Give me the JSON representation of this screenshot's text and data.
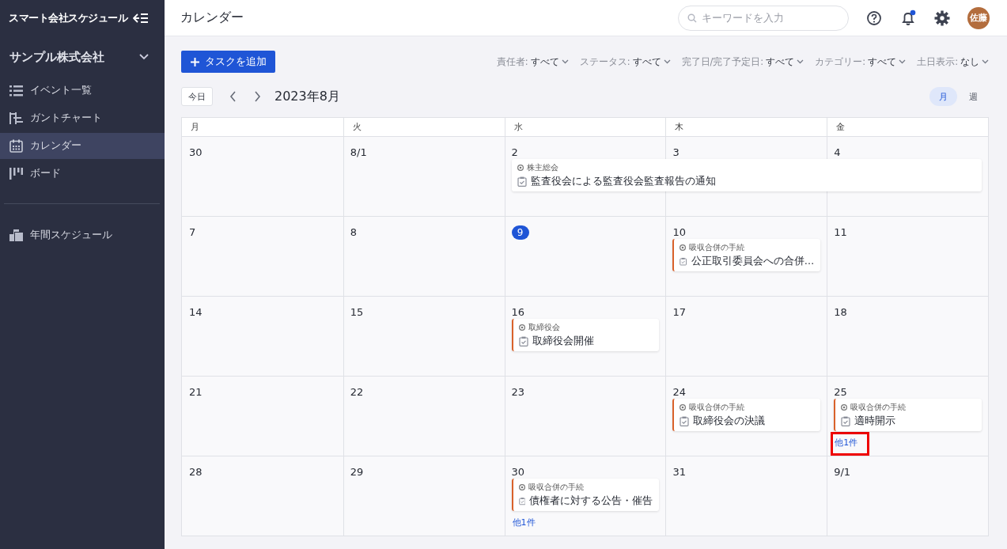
{
  "app": {
    "title": "スマート会社スケジュール",
    "company": "サンプル株式会社"
  },
  "sidebar": {
    "items": [
      {
        "label": "イベント一覧",
        "selected": false
      },
      {
        "label": "ガントチャート",
        "selected": false
      },
      {
        "label": "カレンダー",
        "selected": true
      },
      {
        "label": "ボード",
        "selected": false
      }
    ],
    "footer_items": [
      {
        "label": "年間スケジュール",
        "selected": false
      }
    ]
  },
  "header": {
    "title": "カレンダー",
    "search": {
      "placeholder": "キーワードを入力"
    },
    "notifications_unread": true,
    "avatar": "佐藤"
  },
  "toolbar": {
    "add_button": "タスクを追加",
    "filters": [
      {
        "label": "責任者:",
        "value": "すべて"
      },
      {
        "label": "ステータス:",
        "value": "すべて"
      },
      {
        "label": "完了日/完了予定日:",
        "value": "すべて"
      },
      {
        "label": "カテゴリー:",
        "value": "すべて"
      },
      {
        "label": "土日表示:",
        "value": "なし"
      }
    ]
  },
  "navigation": {
    "today_button": "今日",
    "month_label": "2023年8月",
    "views": [
      {
        "label": "月",
        "selected": true
      },
      {
        "label": "週",
        "selected": false
      }
    ]
  },
  "calendar": {
    "columns": [
      "月",
      "火",
      "水",
      "木",
      "金"
    ],
    "weeks": [
      {
        "days": [
          {
            "date": "30",
            "today": false
          },
          {
            "date": "8/1",
            "today": false
          },
          {
            "date": "2",
            "today": false,
            "events": [
              {
                "kind": "multi-day",
                "category": "株主総会",
                "title": "監査役会による監査役会監査報告の通知"
              }
            ]
          },
          {
            "date": "3",
            "today": false
          },
          {
            "date": "4",
            "today": false
          }
        ]
      },
      {
        "days": [
          {
            "date": "7",
            "today": false
          },
          {
            "date": "8",
            "today": false
          },
          {
            "date": "9",
            "today": true
          },
          {
            "date": "10",
            "today": false,
            "events": [
              {
                "kind": "single-day",
                "category": "吸収合併の手続",
                "title": "公正取引委員会への合併…"
              }
            ]
          },
          {
            "date": "11",
            "today": false
          }
        ]
      },
      {
        "days": [
          {
            "date": "14",
            "today": false
          },
          {
            "date": "15",
            "today": false
          },
          {
            "date": "16",
            "today": false,
            "events": [
              {
                "kind": "single-day",
                "category": "取締役会",
                "title": "取締役会開催"
              }
            ]
          },
          {
            "date": "17",
            "today": false
          },
          {
            "date": "18",
            "today": false
          }
        ]
      },
      {
        "days": [
          {
            "date": "21",
            "today": false
          },
          {
            "date": "22",
            "today": false
          },
          {
            "date": "23",
            "today": false
          },
          {
            "date": "24",
            "today": false,
            "events": [
              {
                "kind": "single-day",
                "category": "吸収合併の手続",
                "title": "取締役会の決議"
              }
            ]
          },
          {
            "date": "25",
            "today": false,
            "events": [
              {
                "kind": "single-day",
                "category": "吸収合併の手続",
                "title": "適時開示"
              }
            ],
            "more": {
              "label": "他1件",
              "highlighted": true
            }
          }
        ]
      },
      {
        "days": [
          {
            "date": "28",
            "today": false
          },
          {
            "date": "29",
            "today": false
          },
          {
            "date": "30",
            "today": false,
            "events": [
              {
                "kind": "single-day",
                "category": "吸収合併の手続",
                "title": "債権者に対する公告・催告"
              }
            ],
            "more": {
              "label": "他1件",
              "highlighted": false
            }
          },
          {
            "date": "31",
            "today": false
          },
          {
            "date": "9/1",
            "today": false
          }
        ]
      }
    ]
  }
}
